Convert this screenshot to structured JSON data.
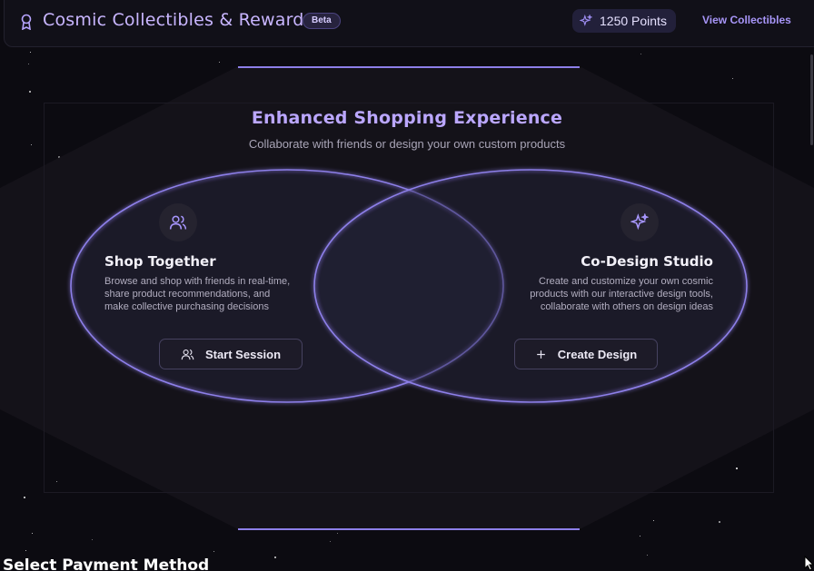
{
  "header": {
    "title": "Cosmic Collectibles & Rewards",
    "badge": "Beta",
    "points_label": "1250 Points",
    "view_link": "View Collectibles",
    "icon": "award-icon",
    "points_icon": "sparkles-icon"
  },
  "section": {
    "title": "Enhanced Shopping Experience",
    "subtitle": "Collaborate with friends or design your own custom products"
  },
  "cards": [
    {
      "title": "Shop Together",
      "description": "Browse and shop with friends in real-time, share product recommendations, and make collective purchasing decisions",
      "button_label": "Start Session",
      "icon": "users-icon",
      "button_icon": "users-icon"
    },
    {
      "title": "Co-Design Studio",
      "description": "Create and customize your own cosmic products with our interactive design tools, collaborate with others on design ideas",
      "button_label": "Create Design",
      "icon": "sparkles-icon",
      "button_icon": "plus-icon"
    }
  ],
  "payment": {
    "heading": "Select Payment Method"
  },
  "colors": {
    "accent": "#a795f7",
    "title_purple": "#bba7ff",
    "background": "#0c0b11",
    "panel": "#141219",
    "ring": "#8d7fe9"
  }
}
